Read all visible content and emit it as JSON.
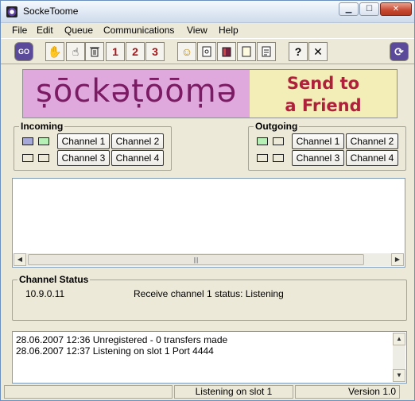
{
  "window": {
    "title": "SockeToome"
  },
  "menu": [
    "File",
    "Edit",
    "Queue",
    "Communications",
    "View",
    "Help"
  ],
  "toolbar": {
    "go_label": "GO",
    "ch1": "1",
    "ch2": "2",
    "ch3": "3",
    "help_label": "?",
    "close_label": "✕"
  },
  "banner": {
    "logo_text": "ṣōckəṭōōṃə",
    "ad_line1": "Send to",
    "ad_line2": "a Friend"
  },
  "incoming": {
    "label": "Incoming",
    "channels": [
      "Channel 1",
      "Channel 2",
      "Channel 3",
      "Channel 4"
    ]
  },
  "outgoing": {
    "label": "Outgoing",
    "channels": [
      "Channel 1",
      "Channel 2",
      "Channel 3",
      "Channel 4"
    ]
  },
  "indicator_colors": {
    "inc_1": "#a5a8d8",
    "inc_2": "#b7f0b7",
    "off": "#ece9d8",
    "out_1": "#b7f0b7"
  },
  "channel_status": {
    "label": "Channel Status",
    "ip": "10.9.0.11",
    "message": "Receive channel  1 status: Listening"
  },
  "log": [
    "28.06.2007 12:36 Unregistered - 0 transfers made",
    "28.06.2007 12:37 Listening on slot  1 Port  4444"
  ],
  "status": {
    "center": "Listening on slot  1",
    "version": "Version 1.0"
  }
}
